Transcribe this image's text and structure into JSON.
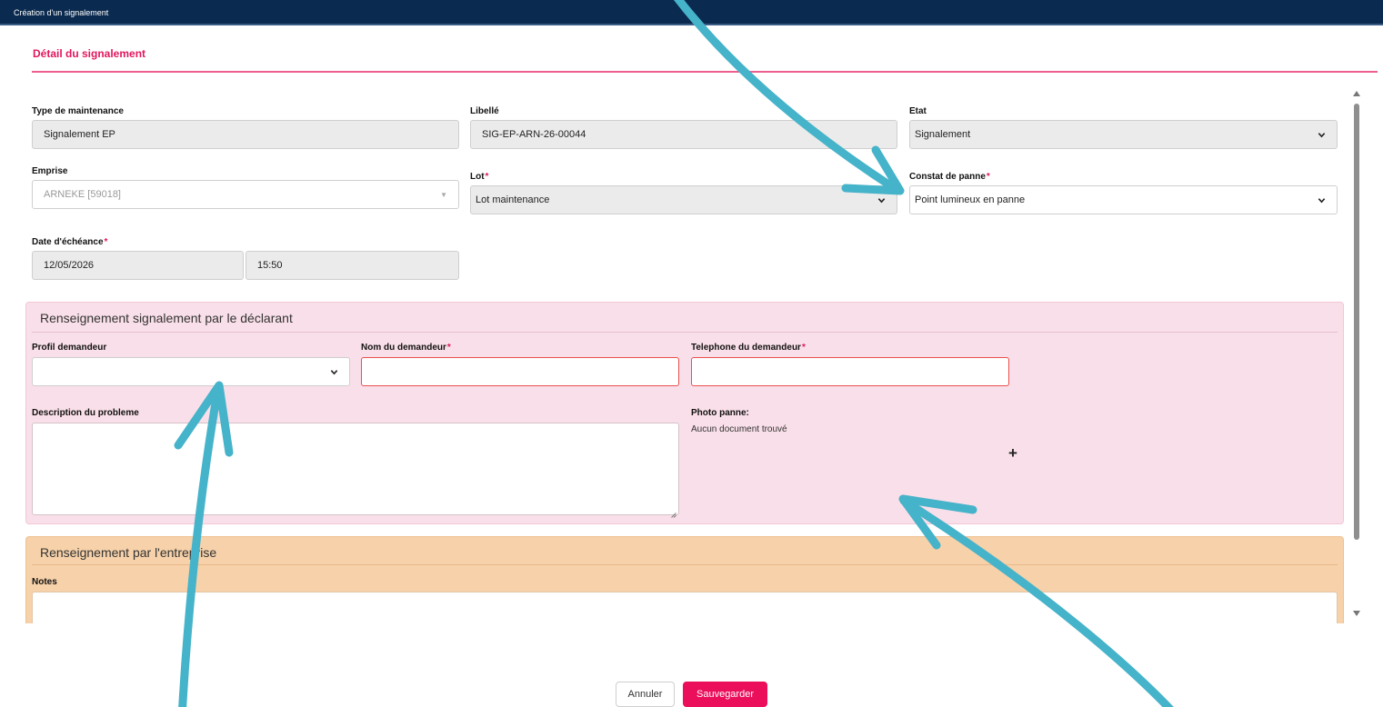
{
  "window": {
    "title": "Création d'un signalement"
  },
  "section": {
    "title": "Détail du signalement"
  },
  "fields": {
    "type_maintenance": {
      "label": "Type de maintenance",
      "value": "Signalement EP"
    },
    "libelle": {
      "label": "Libellé",
      "value": "SIG-EP-ARN-26-00044"
    },
    "etat": {
      "label": "Etat",
      "value": "Signalement"
    },
    "emprise": {
      "label": "Emprise",
      "value": "ARNEKE [59018]"
    },
    "lot": {
      "label": "Lot",
      "required_mark": "*",
      "value": "Lot maintenance"
    },
    "constat": {
      "label": "Constat de panne",
      "required_mark": "*",
      "value": "Point lumineux en panne"
    },
    "date_echeance": {
      "label": "Date d'échéance",
      "required_mark": "*",
      "date": "12/05/2026",
      "time": "15:50"
    }
  },
  "declarant": {
    "title": "Renseignement signalement par le déclarant",
    "profil": {
      "label": "Profil demandeur",
      "value": ""
    },
    "nom": {
      "label": "Nom du demandeur",
      "required_mark": "*",
      "value": ""
    },
    "telephone": {
      "label": "Telephone du demandeur",
      "required_mark": "*",
      "value": ""
    },
    "description": {
      "label": "Description du probleme",
      "value": ""
    },
    "photo": {
      "label": "Photo panne:",
      "empty_text": "Aucun document trouvé",
      "add_symbol": "+"
    }
  },
  "entreprise": {
    "title": "Renseignement par l'entreprise",
    "notes": {
      "label": "Notes",
      "value": ""
    }
  },
  "actions": {
    "cancel_label": "Annuler",
    "save_label": "Sauvegarder"
  },
  "colors": {
    "header_bg": "#0b2a4f",
    "accent": "#e2175e",
    "save_button": "#ea0e5b",
    "declarant_panel": "#f9dfe9",
    "entreprise_panel": "#f6d1a9",
    "error_border": "#e8504c",
    "annotation_arrows": "#45b3c9"
  }
}
